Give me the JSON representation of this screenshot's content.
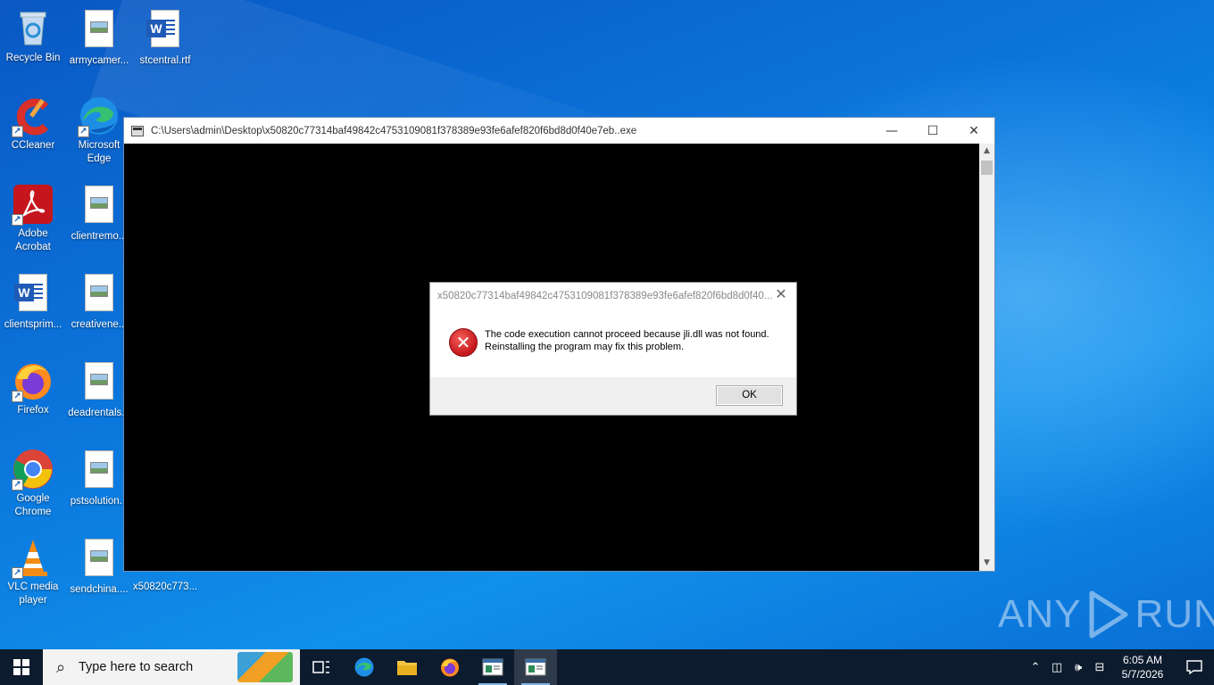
{
  "desktop": {
    "icons": [
      {
        "label": "Recycle Bin"
      },
      {
        "label": "armycamer..."
      },
      {
        "label": "stcentral.rtf"
      },
      {
        "label": "CCleaner"
      },
      {
        "label": "Microsoft Edge"
      },
      {
        "label": "Adobe Acrobat"
      },
      {
        "label": "clientremo..."
      },
      {
        "label": "clientsprim..."
      },
      {
        "label": "creativene..."
      },
      {
        "label": "Firefox"
      },
      {
        "label": "deadrentals..."
      },
      {
        "label": "Google Chrome"
      },
      {
        "label": "pstsolution..."
      },
      {
        "label": "VLC media player"
      },
      {
        "label": "sendchina...."
      },
      {
        "label": "x50820c773..."
      }
    ]
  },
  "console": {
    "title": "C:\\Users\\admin\\Desktop\\x50820c77314baf49842c4753109081f378389e93fe6afef820f6bd8d0f40e7eb..exe",
    "minimize": "—",
    "maximize": "☐",
    "close": "✕"
  },
  "dialog": {
    "title": "x50820c77314baf49842c4753109081f378389e93fe6afef820f6bd8d0f40...",
    "message": "The code execution cannot proceed because jli.dll was not found. Reinstalling the program may fix this problem.",
    "ok_label": "OK",
    "icon": "error-icon"
  },
  "watermark": {
    "left": "ANY",
    "right": "RUN"
  },
  "taskbar": {
    "search_placeholder": "Type here to search",
    "time": "6:05 AM",
    "date": "5/7/2026"
  }
}
